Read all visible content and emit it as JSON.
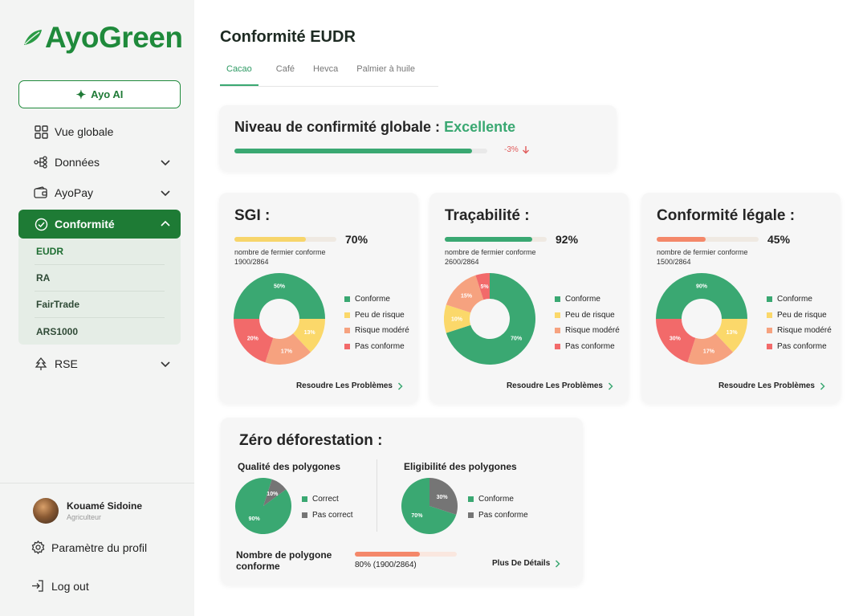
{
  "brand": {
    "name": "AyoGreen",
    "color": "#1f8a3b"
  },
  "sidebar": {
    "ai_button": "Ayo AI",
    "items": [
      {
        "label": "Vue globale",
        "icon": "grid-icon"
      },
      {
        "label": "Données",
        "icon": "data-icon"
      },
      {
        "label": "AyoPay",
        "icon": "wallet-icon"
      },
      {
        "label": "Conformité",
        "icon": "check-circle-icon"
      },
      {
        "label": "RSE",
        "icon": "tree-icon"
      }
    ],
    "sub_items": [
      "EUDR",
      "RA",
      "FairTrade",
      "ARS1000"
    ],
    "profile": {
      "name": "Kouamé Sidoine",
      "role": "Agriculteur"
    },
    "settings": "Paramètre du profil",
    "logout": "Log out"
  },
  "page": {
    "title": "Conformité EUDR",
    "tabs": [
      "Cacao",
      "Café",
      "Hevca",
      "Palmier à huile"
    ]
  },
  "global_level": {
    "label": "Niveau de confirmité globale : ",
    "status": "Excellente",
    "progress": 0.94,
    "trend": "-3%"
  },
  "legend_labels": [
    "Conforme",
    "Peu de risque",
    "Risque modéré",
    "Pas conforme"
  ],
  "resolve_label": "Resoudre Les Problèmes",
  "kpis": [
    {
      "title": "SGI :",
      "percent": "70%",
      "progress": 0.7,
      "bar_color": "#f7d56b",
      "sub_label": "nombre de fermier conforme",
      "count": "1900/2864",
      "slices": [
        {
          "label": "50%",
          "value": 50,
          "color": "#3aa872"
        },
        {
          "label": "13%",
          "value": 13,
          "color": "#fbd86a"
        },
        {
          "label": "17%",
          "value": 17,
          "color": "#f6a27f"
        },
        {
          "label": "20%",
          "value": 20,
          "color": "#f26a6a"
        }
      ]
    },
    {
      "title": "Traçabilité :",
      "percent": "92%",
      "progress": 0.86,
      "bar_color": "#3aa872",
      "sub_label": "nombre de fermier conforme",
      "count": "2600/2864",
      "slices": [
        {
          "label": "70%",
          "value": 70,
          "color": "#3aa872"
        },
        {
          "label": "10%",
          "value": 10,
          "color": "#fbd86a"
        },
        {
          "label": "15%",
          "value": 15,
          "color": "#f6a27f"
        },
        {
          "label": "5%",
          "value": 5,
          "color": "#f26a6a"
        }
      ]
    },
    {
      "title": "Conformité légale :",
      "percent": "45%",
      "progress": 0.48,
      "bar_color": "#f4886a",
      "sub_label": "nombre de fermier conforme",
      "count": "1500/2864",
      "slices": [
        {
          "label": "90%",
          "value": 50,
          "color": "#3aa872"
        },
        {
          "label": "13%",
          "value": 13,
          "color": "#fbd86a"
        },
        {
          "label": "17%",
          "value": 17,
          "color": "#f6a27f"
        },
        {
          "label": "30%",
          "value": 20,
          "color": "#f26a6a"
        }
      ]
    }
  ],
  "deforestation": {
    "title": "Zéro déforestation :",
    "quality": {
      "title": "Qualité des polygones",
      "legend": [
        "Correct",
        "Pas correct"
      ],
      "slices": [
        {
          "label": "90%",
          "value": 90,
          "color": "#3aa872"
        },
        {
          "label": "10%",
          "value": 10,
          "color": "#757575"
        }
      ]
    },
    "eligibility": {
      "title": "Eligibilité des polygones",
      "legend": [
        "Conforme",
        "Pas conforme"
      ],
      "slices": [
        {
          "label": "70%",
          "value": 70,
          "color": "#3aa872"
        },
        {
          "label": "30%",
          "value": 30,
          "color": "#757575"
        }
      ]
    },
    "footer_label": "Nombre de polygone conforme",
    "footer_value": "80%",
    "footer_count": "(1900/2864)",
    "progress": 0.64,
    "more": "Plus De Détails"
  },
  "colors": {
    "accent": "#3aa872",
    "active_nav": "#1e7b35",
    "negative": "#e05a5a"
  }
}
